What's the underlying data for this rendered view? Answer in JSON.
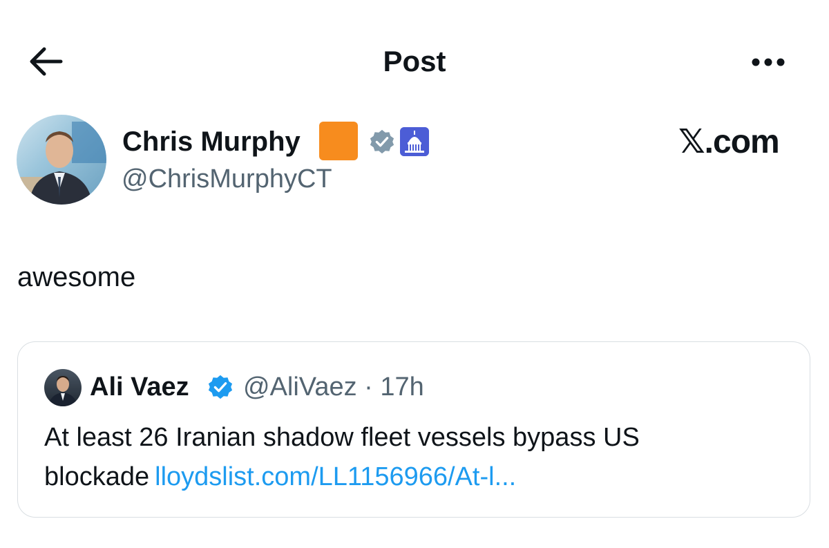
{
  "header": {
    "title": "Post",
    "back_icon": "arrow-left-icon",
    "more_icon": "more-horizontal-icon"
  },
  "author": {
    "display_name": "Chris Murphy",
    "handle": "@ChrisMurphyCT",
    "badges": [
      "orange-square-emoji",
      "gray-verified-icon",
      "capitol-building-icon"
    ]
  },
  "brand": "𝕏.com",
  "post": {
    "text": "awesome"
  },
  "quote": {
    "display_name": "Ali Vaez",
    "handle_time": "@AliVaez · 17h",
    "text": "At least 26 Iranian shadow fleet vessels bypass US blockade",
    "link": "lloydslist.com/LL1156966/At-l..."
  },
  "colors": {
    "accent_blue": "#1d9bf0",
    "secondary_text": "#536471",
    "orange_badge": "#f78c1e",
    "gray_badge": "#829aab",
    "capitol_badge": "#4c5dd6"
  }
}
